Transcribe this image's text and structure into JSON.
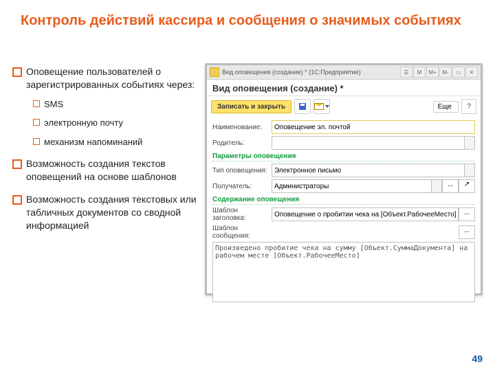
{
  "slide": {
    "title": "Контроль действий кассира и сообщения о значимых событиях",
    "page_number": "49"
  },
  "bullets": {
    "b1": "Оповещение пользователей о зарегистрированных событиях через:",
    "b1a": "SMS",
    "b1b": "электронную почту",
    "b1c": "механизм напоминаний",
    "b2": "Возможность создания текстов оповещений на основе шаблонов",
    "b3": "Возможность создания текстовых или табличных документов со сводной информацией"
  },
  "window": {
    "titlebar": "Вид оповещения (создание) *   (1С:Предприятие)",
    "heading": "Вид оповещения (создание) *",
    "btn_save_close": "Записать и закрыть",
    "btn_more": "Еще",
    "btn_help": "?",
    "labels": {
      "name": "Наименование:",
      "parent": "Родитель:",
      "section_params": "Параметры оповещения",
      "type": "Тип оповещения:",
      "recipient": "Получатель:",
      "section_content": "Содержание оповещения",
      "subject_tpl": "Шаблон заголовка:",
      "body_tpl": "Шаблон сообщения:"
    },
    "values": {
      "name": "Оповещение эл. почтой",
      "parent": "",
      "type": "Электронное письмо",
      "recipient": "Администраторы",
      "subject_tpl": "Оповещение о пробитии чека на [Объект.РабочееМесто]",
      "body_tpl": "Произведено пробитие чека на сумму [Объект.СуммаДокумента] на рабочем месте [Объект.РабочееМесто]"
    },
    "dots": "..."
  }
}
